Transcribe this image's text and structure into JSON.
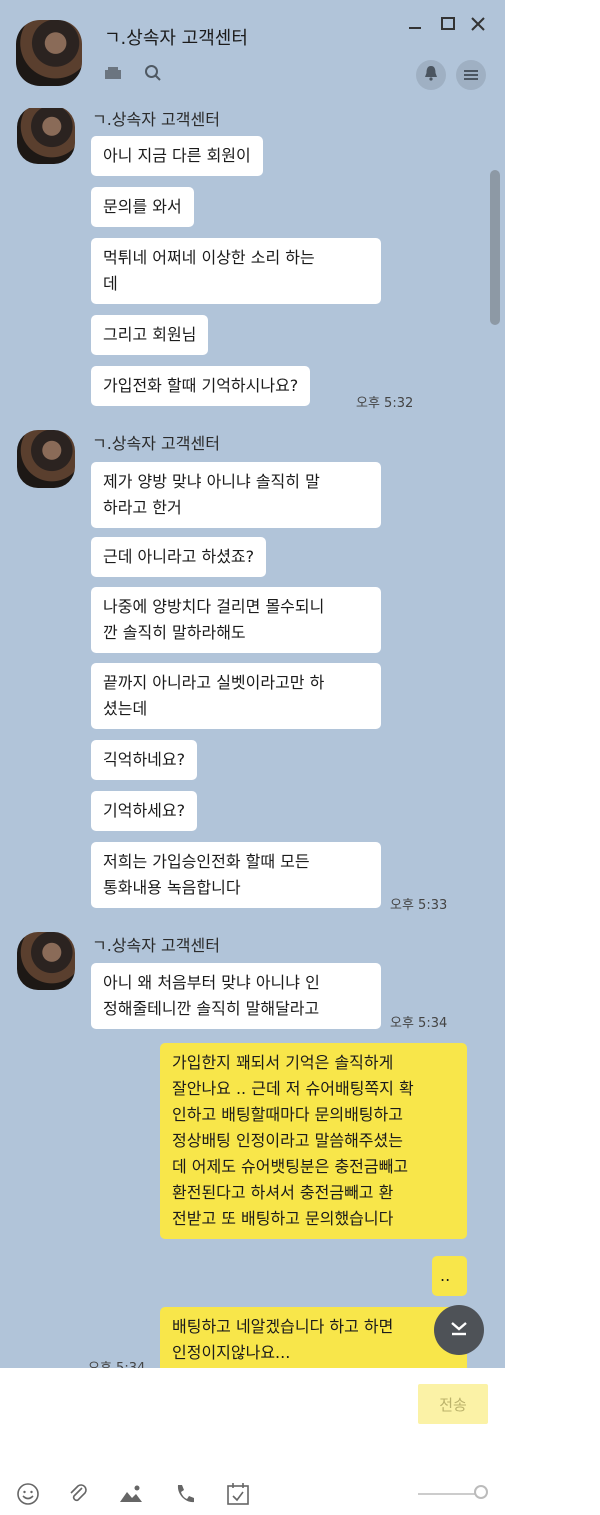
{
  "header": {
    "title": "ㄱ.상속자 고객센터"
  },
  "messages": [
    {
      "sender": "ㄱ.상속자 고객센터",
      "time": "오후 5:32",
      "bubbles": [
        "아니 지금 다른 회원이",
        "문의를 와서",
        "먹튀네 어쩌네 이상한 소리 하는\n데",
        "그리고 회원님",
        "가입전화 할때 기억하시나요?"
      ]
    },
    {
      "sender": "ㄱ.상속자 고객센터",
      "time": "오후 5:33",
      "bubbles": [
        "제가 양방 맞냐 아니냐 솔직히 말\n하라고 한거",
        "근데 아니라고 하셨죠?",
        "나중에 양방치다 걸리면 몰수되니\n깐 솔직히 말하라해도",
        "끝까지 아니라고 실벳이라고만 하\n셨는데",
        "긱억하네요?",
        "기억하세요?",
        "저희는 가입승인전화 할때 모든\n통화내용 녹음합니다"
      ]
    },
    {
      "sender": "ㄱ.상속자 고객센터",
      "time": "오후 5:34",
      "bubbles": [
        "아니 왜 처음부터 맞냐 아니냐 인\n정해줄테니깐 솔직히 말해달라고"
      ]
    },
    {
      "sender": "me",
      "time": "오후 5:34",
      "bubbles": [
        "가입한지 꽤되서 기억은 솔직하게\n잘안나요 .. 근데 저 슈어배팅쪽지 확\n인하고 배팅할때마다 문의배팅하고\n정상배팅 인정이라고 말씀해주셨는\n데 어제도 슈어뱃팅분은 충전금빼고\n 환전된다고 하셔서 충전금빼고 환\n전받고 또 배팅하고 문의했습니다",
        "..",
        "배팅하고 네알겠습니다 하고 하면\n인정이지않나요..."
      ]
    }
  ],
  "input": {
    "send_label": "전송"
  },
  "toolbar": {
    "icons": [
      "emoji-icon",
      "attach-icon",
      "image-icon",
      "call-icon",
      "calendar-icon"
    ]
  },
  "icons": {
    "header": [
      "drawer-icon",
      "search-icon",
      "minimize-icon",
      "maximize-icon",
      "close-icon",
      "bell-icon",
      "menu-icon"
    ],
    "scroll": "chevron-down-icon"
  }
}
